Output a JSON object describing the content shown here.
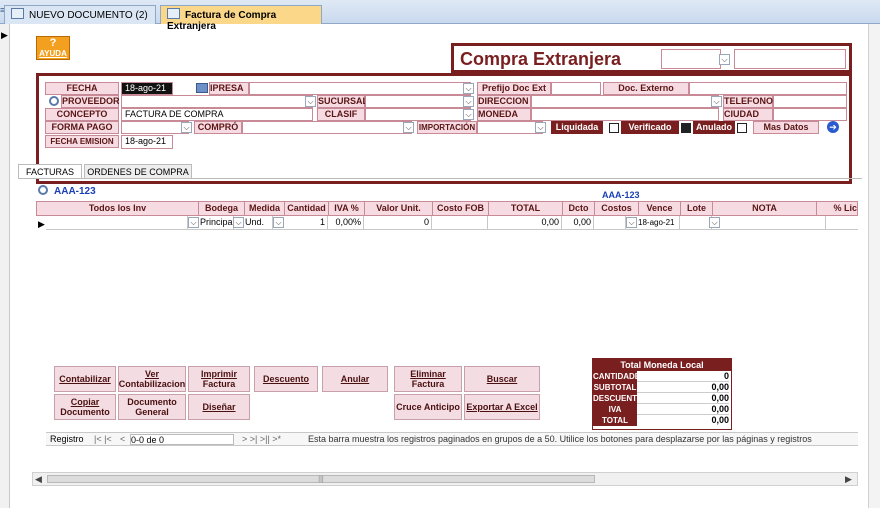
{
  "tabs": {
    "doc1": "NUEVO DOCUMENTO (2)",
    "doc2": "Factura de Compra Extranjera"
  },
  "ayuda": {
    "mark": "?",
    "label": "AYUDA"
  },
  "title": "Compra Extranjera",
  "header": {
    "fecha_label": "FECHA",
    "fecha_value": "18-ago-21",
    "empresa_label": "IPRESA",
    "prefijo_label": "Prefijo Doc Ext",
    "doc_externo_label": "Doc. Externo",
    "proveedor_label": "PROVEEDOR",
    "sucursal_label": "SUCURSAL",
    "direccion_label": "DIRECCION",
    "telefono_label": "TELEFONO",
    "concepto_label": "CONCEPTO",
    "concepto_value": "FACTURA DE COMPRA",
    "clasif_label": "CLASIF",
    "moneda_label": "MONEDA",
    "ciudad_label": "CIUDAD",
    "forma_pago_label": "FORMA PAGO",
    "compro_label": "COMPRÓ",
    "importacion_label": "IMPORTACIÓN",
    "liquidada_label": "Liquidada",
    "verificado_label": "Verificado",
    "anulado_label": "Anulado",
    "mas_datos_label": "Mas Datos",
    "fecha_emision_label": "FECHA EMISION",
    "fecha_emision_value": "18-ago-21",
    "verificado_checked": true
  },
  "subtabs": [
    "FACTURAS",
    "ORDENES DE COMPRA"
  ],
  "search_code_left": "AAA-123",
  "search_code_right": "AAA-123",
  "grid": {
    "headers": [
      "Todos los Inv",
      "Bodega",
      "Medida",
      "Cantidad",
      "IVA %",
      "Valor Unit.",
      "Costo FOB",
      "TOTAL",
      "Dcto",
      "Costos",
      "Vence",
      "Lote",
      "NOTA",
      "% Lic"
    ],
    "row": {
      "item": "",
      "bodega": "Principa",
      "medida": "Und.",
      "cantidad": "1",
      "iva": "0,00%",
      "valor": "0",
      "costo_fob": "",
      "total": "0,00",
      "dcto": "0,00",
      "costos": "",
      "vence": "18-ago-21",
      "lote": "",
      "nota": ""
    }
  },
  "buttons": {
    "contabilizar": "Contabilizar",
    "ver_contab_1": "Ver",
    "ver_contab_2": "Contabilizacion",
    "imprimir_1": "Imprimir",
    "imprimir_2": "Factura",
    "descuento": "Descuento",
    "anular": "Anular",
    "eliminar_1": "Eliminar",
    "eliminar_2": "Factura",
    "buscar": "Buscar",
    "copiar_1": "Copiar",
    "copiar_2": "Documento",
    "documento_1": "Documento",
    "documento_2": "General",
    "disenar": "Diseñar",
    "cruce": "Cruce Anticipo",
    "exportar": "Exportar A Excel"
  },
  "totals": {
    "title": "Total Moneda Local",
    "rows": [
      {
        "label": "CANTIDADES",
        "value": "0"
      },
      {
        "label": "SUBTOTAL",
        "value": "0,00"
      },
      {
        "label": "DESCUENTO",
        "value": "0,00"
      },
      {
        "label": "IVA",
        "value": "0,00"
      },
      {
        "label": "TOTAL",
        "value": "0,00"
      }
    ]
  },
  "navbar": {
    "registro": "Registro",
    "first_prev": "|< |<",
    "prev": "<",
    "position": "0-0 de 0",
    "next_last": "> >| >|| >*",
    "hint": "Esta barra muestra los registros paginados en grupos de a 50. Utilice los botones para desplazarse por las páginas y registros"
  },
  "colors": {
    "maroon": "#7a1f1f",
    "pink": "#f6dce2",
    "blue_code": "#1a3fb4",
    "tab_active": "#fbd78a"
  }
}
